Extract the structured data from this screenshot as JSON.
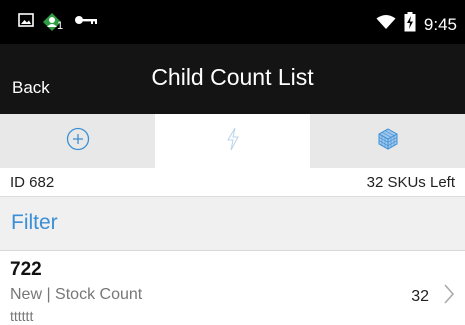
{
  "status_bar": {
    "time": "9:45",
    "icons": [
      "image-icon",
      "person-badge-icon",
      "key-icon",
      "wifi-icon",
      "battery-charging-icon"
    ],
    "badge_number": "1"
  },
  "header": {
    "back_label": "Back",
    "title": "Child Count List"
  },
  "tabs": [
    {
      "icon": "add-circle-icon",
      "state": "normal"
    },
    {
      "icon": "lightning-icon",
      "state": "selected"
    },
    {
      "icon": "cube-grid-icon",
      "state": "normal"
    }
  ],
  "info": {
    "id_text": "ID 682",
    "skus_left": "32 SKUs Left"
  },
  "filter": {
    "label": "Filter"
  },
  "list": [
    {
      "number": "722",
      "status": "New | Stock Count",
      "note": "tttttt",
      "count": "32"
    }
  ],
  "colors": {
    "accent": "#3a8fd6",
    "header_bg": "#141414",
    "status_bg": "#000000"
  }
}
